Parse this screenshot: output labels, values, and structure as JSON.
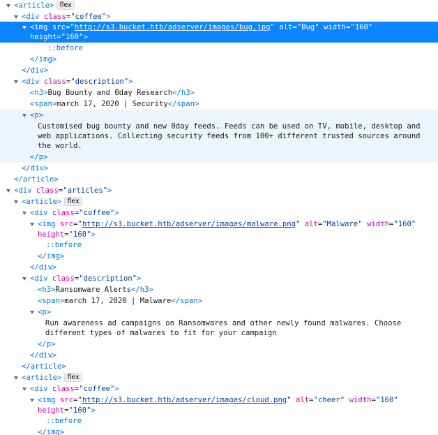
{
  "markup": {
    "article_tag": "article",
    "div_tag": "div",
    "img_tag": "img",
    "h3_tag": "h3",
    "span_tag": "span",
    "p_tag": "p",
    "class_attr": "class",
    "src_attr": "src",
    "alt_attr": "alt",
    "width_attr": "width",
    "height_attr": "height",
    "flex_badge": "flex",
    "before_pseudo": "::before",
    "coffee_class": "\"coffee\"",
    "description_class": "\"description\"",
    "articles_class": "\"articles\"",
    "width_value": "\"160\"",
    "height_value": "\"160\""
  },
  "articles": [
    {
      "img_src": "http://s3.bucket.htb/adserver/images/bug.jpg",
      "img_alt": "\"Bug\"",
      "title": "Bug Bounty and 0day Research",
      "meta": "march 17, 2020 | Security",
      "body": "Customised bug bounty and new 0day feeds. Feeds can be used on TV, mobile, desktop and web applications. Collecting security feeds from 100+ different trusted sources around the world."
    },
    {
      "img_src": "http://s3.bucket.htb/adserver/images/malware.png",
      "img_alt": "\"Malware\"",
      "title": "Ransomware Alerts",
      "meta": "march 17, 2020 | Malware",
      "body": "Run awareness ad campaigns on Ransomwares and other newly found malwares. Choose different types of malwares to fit for your campaign"
    },
    {
      "img_src": "http://s3.bucket.htb/adserver/images/cloud.png",
      "img_alt": "\"cheer\""
    }
  ]
}
